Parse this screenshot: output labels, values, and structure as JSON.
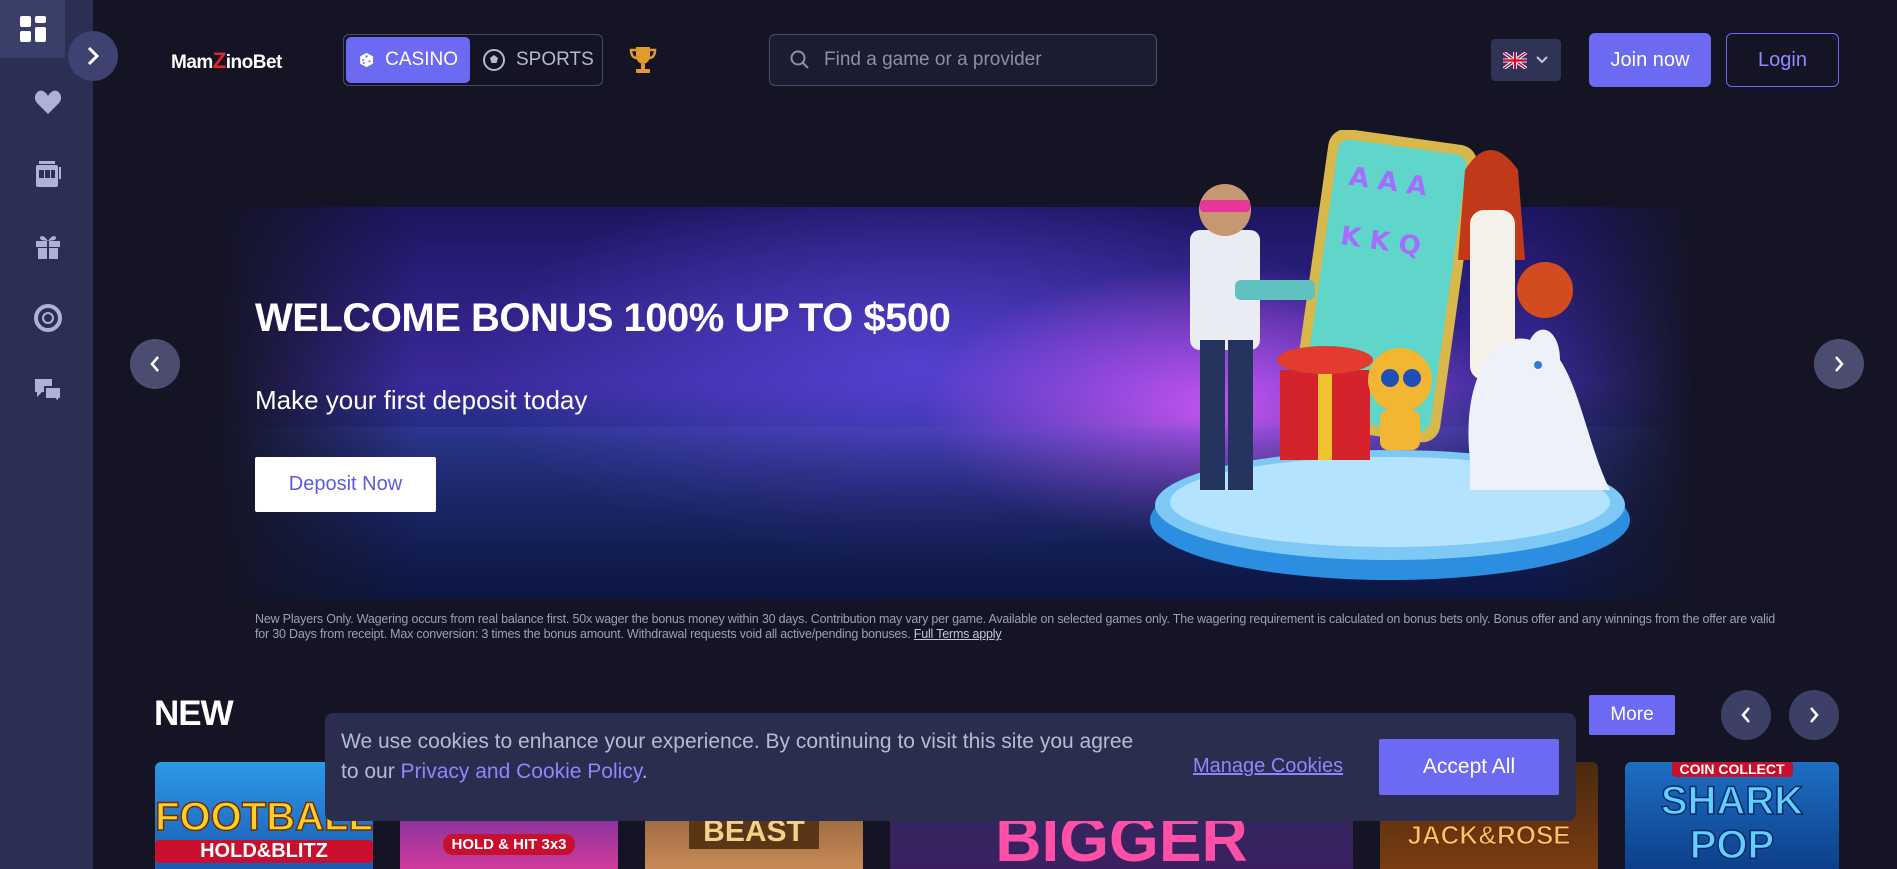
{
  "brand": {
    "logo_prefix": "Mam",
    "logo_z": "Z",
    "logo_suffix": "inoBet"
  },
  "header": {
    "tabs": [
      {
        "label": "CASINO",
        "icon": "dice-icon",
        "active": true
      },
      {
        "label": "SPORTS",
        "icon": "soccer-ball-icon",
        "active": false
      }
    ],
    "search_placeholder": "Find a game or a provider",
    "language": "uk-flag-icon",
    "join_label": "Join now",
    "login_label": "Login"
  },
  "sidebar": {
    "items": [
      {
        "icon": "dashboard-icon"
      },
      {
        "icon": "heart-icon"
      },
      {
        "icon": "slot-machine-icon"
      },
      {
        "icon": "gift-icon"
      },
      {
        "icon": "lifebuoy-icon"
      },
      {
        "icon": "chat-support-icon"
      }
    ]
  },
  "banner": {
    "title": "WELCOME BONUS 100% UP TO $500",
    "subtitle": "Make your first deposit today",
    "cta_label": "Deposit Now",
    "terms": "New Players Only. Wagering occurs from real balance first. 50x wager the bonus money within 30 days. Contribution may vary per game. Available on selected games only. The wagering requirement is calculated on bonus bets only. Bonus offer and any winnings from the offer are valid for 30 Days from receipt. Max conversion: 3 times the bonus amount. Withdrawal requests void all active/pending bonuses.",
    "terms_link": "Full Terms apply"
  },
  "new_section": {
    "title": "NEW",
    "more_label": "More",
    "games": [
      {
        "name": "FOOTBALL",
        "sub": "HOLD&BLITZ"
      },
      {
        "name": "",
        "sub": "HOLD & HIT 3x3"
      },
      {
        "name": "BEAST",
        "sub": ""
      },
      {
        "name": "BIGGER",
        "sub": ""
      },
      {
        "name": "JACK&ROSE",
        "sub": ""
      },
      {
        "name": "SHARK POP",
        "sub": "COIN COLLECT"
      }
    ]
  },
  "cookie": {
    "text": "We use cookies to enhance your experience. By continuing to visit this site you agree to our ",
    "link": "Privacy and Cookie Policy",
    "link_suffix": ".",
    "manage_label": "Manage Cookies",
    "accept_label": "Accept All"
  },
  "colors": {
    "accent": "#6c69f2",
    "sidebar": "#2b2f54",
    "background": "#141424"
  }
}
